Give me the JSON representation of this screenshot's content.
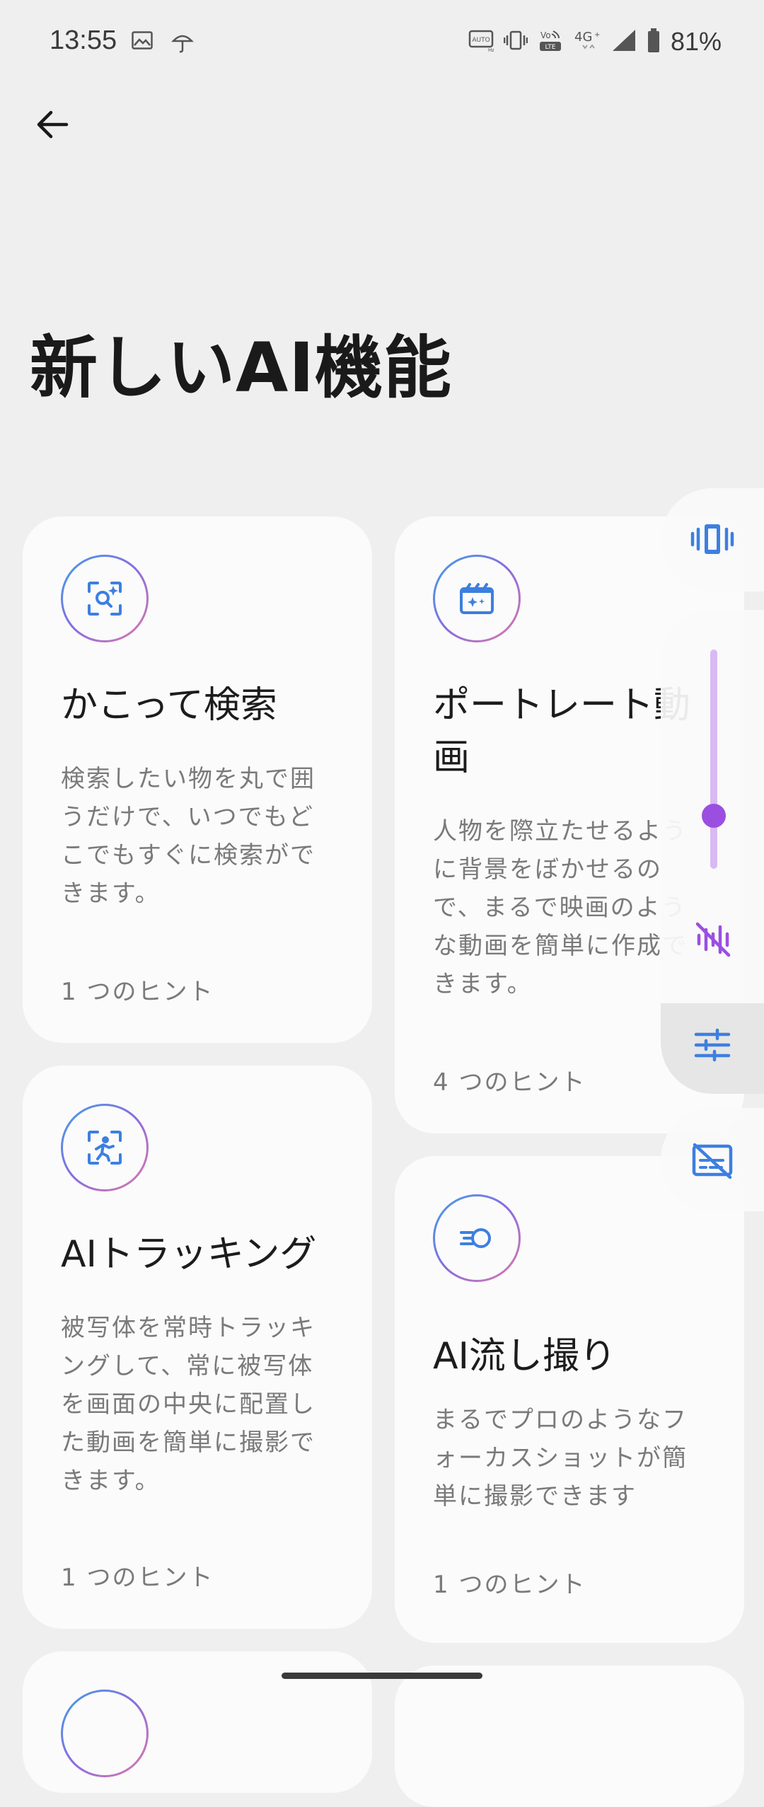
{
  "status_bar": {
    "time": "13:55",
    "battery": "81%",
    "network": "4G"
  },
  "page": {
    "title": "新しいAI機能"
  },
  "cards": [
    {
      "title": "かこって検索",
      "description": "検索したい物を丸で囲\nうだけで、いつでもど\nこでもすぐに検索がで\nきます。",
      "hint": "1 つのヒント",
      "icon": "circle-search-icon"
    },
    {
      "title": "ポートレート動\n画",
      "description": "人物を際立たせるよう\nに背景をぼかせるの\nで、まるで映画のよう\nな動画を簡単に作成で\nきます。",
      "hint": "4 つのヒント",
      "icon": "clapperboard-icon"
    },
    {
      "title": "AIトラッキング",
      "description": "被写体を常時トラッキ\nングして、常に被写体\nを画面の中央に配置し\nた動画を簡単に撮影で\nきます。",
      "hint": "1 つのヒント",
      "icon": "person-tracking-icon"
    },
    {
      "title": "AI流し撮り",
      "description": "まるでプロのようなフ\nォーカスショットが簡\n単に撮影できます",
      "hint": "1 つのヒント",
      "icon": "motion-blur-icon"
    }
  ],
  "volume_panel": {
    "level": 0.25,
    "accent": "#9b4fe0"
  },
  "colors": {
    "background": "#efefef",
    "card": "#fbfbfb",
    "icon_blue": "#3d7fe0"
  }
}
